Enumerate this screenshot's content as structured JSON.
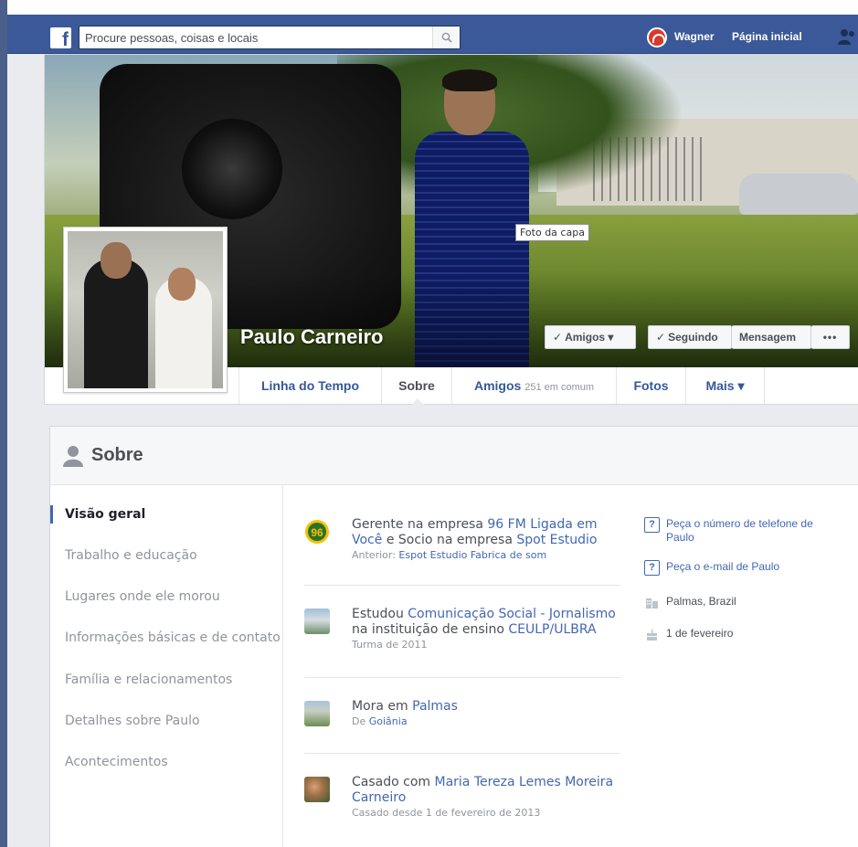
{
  "topbar": {
    "logo": "f",
    "search_placeholder": "Procure pessoas, coisas e locais",
    "search_icon": "search-icon",
    "user_name": "Wagner",
    "home_label": "Página inicial",
    "brand_color": "#3b5998"
  },
  "profile": {
    "name": "Paulo Carneiro",
    "cover_tooltip": "Foto da capa",
    "buttons": {
      "friends": "Amigos",
      "following": "Seguindo",
      "message": "Mensagem",
      "more": "•••"
    }
  },
  "tabs": {
    "timeline": "Linha do Tempo",
    "about": "Sobre",
    "friends": "Amigos",
    "friends_count": "251 em comum",
    "photos": "Fotos",
    "more": "Mais"
  },
  "about": {
    "title": "Sobre",
    "nav": [
      {
        "label": "Visão geral",
        "active": true
      },
      {
        "label": "Trabalho e educação",
        "active": false
      },
      {
        "label": "Lugares onde ele morou",
        "active": false
      },
      {
        "label": "Informações básicas e de contato",
        "active": false
      },
      {
        "label": "Família e relacionamentos",
        "active": false
      },
      {
        "label": "Detalhes sobre Paulo",
        "active": false
      },
      {
        "label": "Acontecimentos",
        "active": false
      }
    ],
    "entries": [
      {
        "pre": "Gerente na empresa ",
        "link1": "96 FM Ligada em Você",
        "mid": " e Socio na empresa ",
        "link2": "Spot Estudio",
        "sub_pre": "Anterior: ",
        "sub_link": "Espot Estudio Fabrica de som"
      },
      {
        "pre": "Estudou ",
        "link1": "Comunicação Social - Jornalismo",
        "mid": " na instituição de ensino ",
        "link2": "CEULP/ULBRA",
        "sub": "Turma de 2011"
      },
      {
        "pre": "Mora em ",
        "link1": "Palmas",
        "sub_pre": "De ",
        "sub_link": "Goiânia"
      },
      {
        "pre": "Casado com ",
        "link1": "Maria Tereza Lemes Moreira Carneiro",
        "sub": "Casado desde 1 de fevereiro de 2013"
      }
    ],
    "side": {
      "phone": "Peça o número de telefone de Paulo",
      "email": "Peça o e-mail de Paulo",
      "location": "Palmas, Brazil",
      "birthday": "1 de fevereiro",
      "q_icon": "?"
    }
  }
}
